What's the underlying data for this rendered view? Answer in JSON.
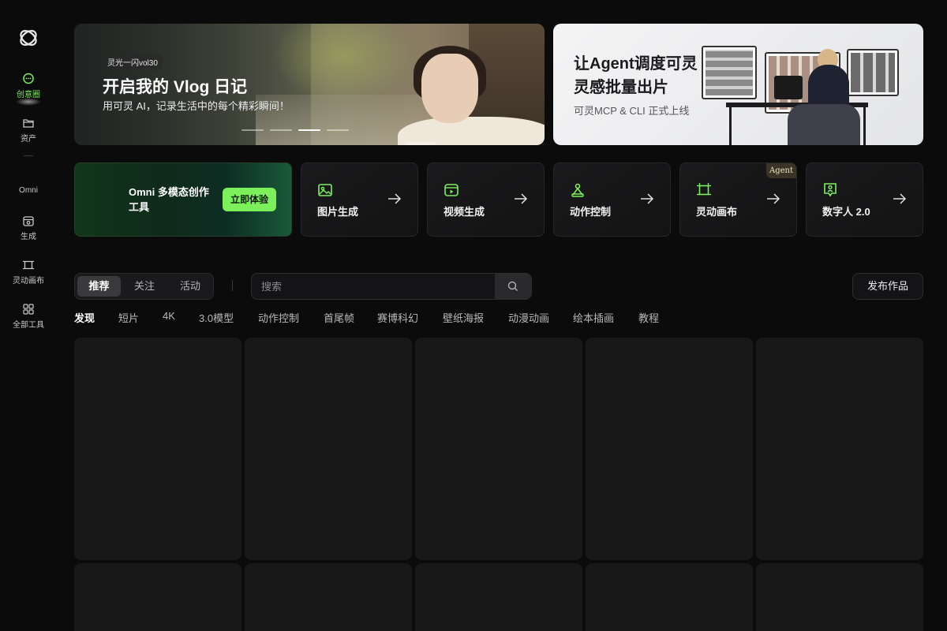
{
  "sidebar": {
    "items": [
      {
        "label": "创意圈",
        "icon": "chat-bubble-icon",
        "active": true
      },
      {
        "label": "资产",
        "icon": "folder-icon",
        "active": false
      },
      {
        "label": "Omni",
        "icon": "",
        "active": false
      },
      {
        "label": "生成",
        "icon": "generate-icon",
        "active": false
      },
      {
        "label": "灵动画布",
        "icon": "canvas-icon",
        "active": false
      },
      {
        "label": "全部工具",
        "icon": "grid-icon",
        "active": false
      }
    ]
  },
  "banners": {
    "left": {
      "tag": "灵光一闪vol30",
      "title": "开启我的 Vlog 日记",
      "subtitle": "用可灵 AI，记录生活中的每个精彩瞬间！",
      "slides": 4,
      "active_slide": 3
    },
    "right": {
      "title_line1": "让Agent调度可灵",
      "title_line2": "灵感批量出片",
      "subtitle": "可灵MCP & CLI 正式上线"
    }
  },
  "omni_card": {
    "title": "Omni 多模态创作工具",
    "button_label": "立即体验"
  },
  "tools": [
    {
      "label": "图片生成",
      "icon": "image-icon"
    },
    {
      "label": "视频生成",
      "icon": "video-icon"
    },
    {
      "label": "动作控制",
      "icon": "motion-icon"
    },
    {
      "label": "灵动画布",
      "icon": "canvas-icon",
      "badge": "Agent"
    },
    {
      "label": "数字人 2.0",
      "icon": "digital-human-icon"
    }
  ],
  "tabs": [
    {
      "label": "推荐",
      "active": true
    },
    {
      "label": "关注",
      "active": false
    },
    {
      "label": "活动",
      "active": false
    }
  ],
  "search": {
    "placeholder": "搜索"
  },
  "publish_label": "发布作品",
  "categories": [
    "发现",
    "短片",
    "4K",
    "3.0模型",
    "动作控制",
    "首尾帧",
    "赛博科幻",
    "壁纸海报",
    "动漫动画",
    "绘本插画",
    "教程"
  ],
  "colors": {
    "accent": "#7cf05a",
    "background": "#0b0b0c",
    "card": "#181819"
  }
}
